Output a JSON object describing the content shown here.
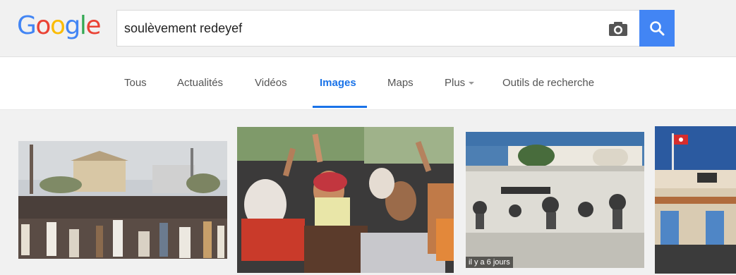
{
  "logo": {
    "letters": [
      "G",
      "o",
      "o",
      "g",
      "l",
      "e"
    ],
    "colors": [
      "#4285F4",
      "#EA4335",
      "#FBBC05",
      "#4285F4",
      "#34A853",
      "#EA4335"
    ]
  },
  "search": {
    "query": "soulèvement redeyef"
  },
  "tabs": [
    {
      "label": "Tous",
      "active": false
    },
    {
      "label": "Actualités",
      "active": false
    },
    {
      "label": "Vidéos",
      "active": false
    },
    {
      "label": "Images",
      "active": true
    },
    {
      "label": "Maps",
      "active": false
    },
    {
      "label": "Plus",
      "active": false,
      "dropdown": true
    },
    {
      "label": "Outils de recherche",
      "active": false
    }
  ],
  "results": [
    {
      "alt": "crowd-in-square",
      "age": ""
    },
    {
      "alt": "protesting-women",
      "age": ""
    },
    {
      "alt": "mural-wall",
      "age": "il y a 6 jours"
    },
    {
      "alt": "station-building-with-flag",
      "age": ""
    }
  ],
  "colors": {
    "accent": "#1a73e8",
    "search_button": "#4285f4"
  }
}
